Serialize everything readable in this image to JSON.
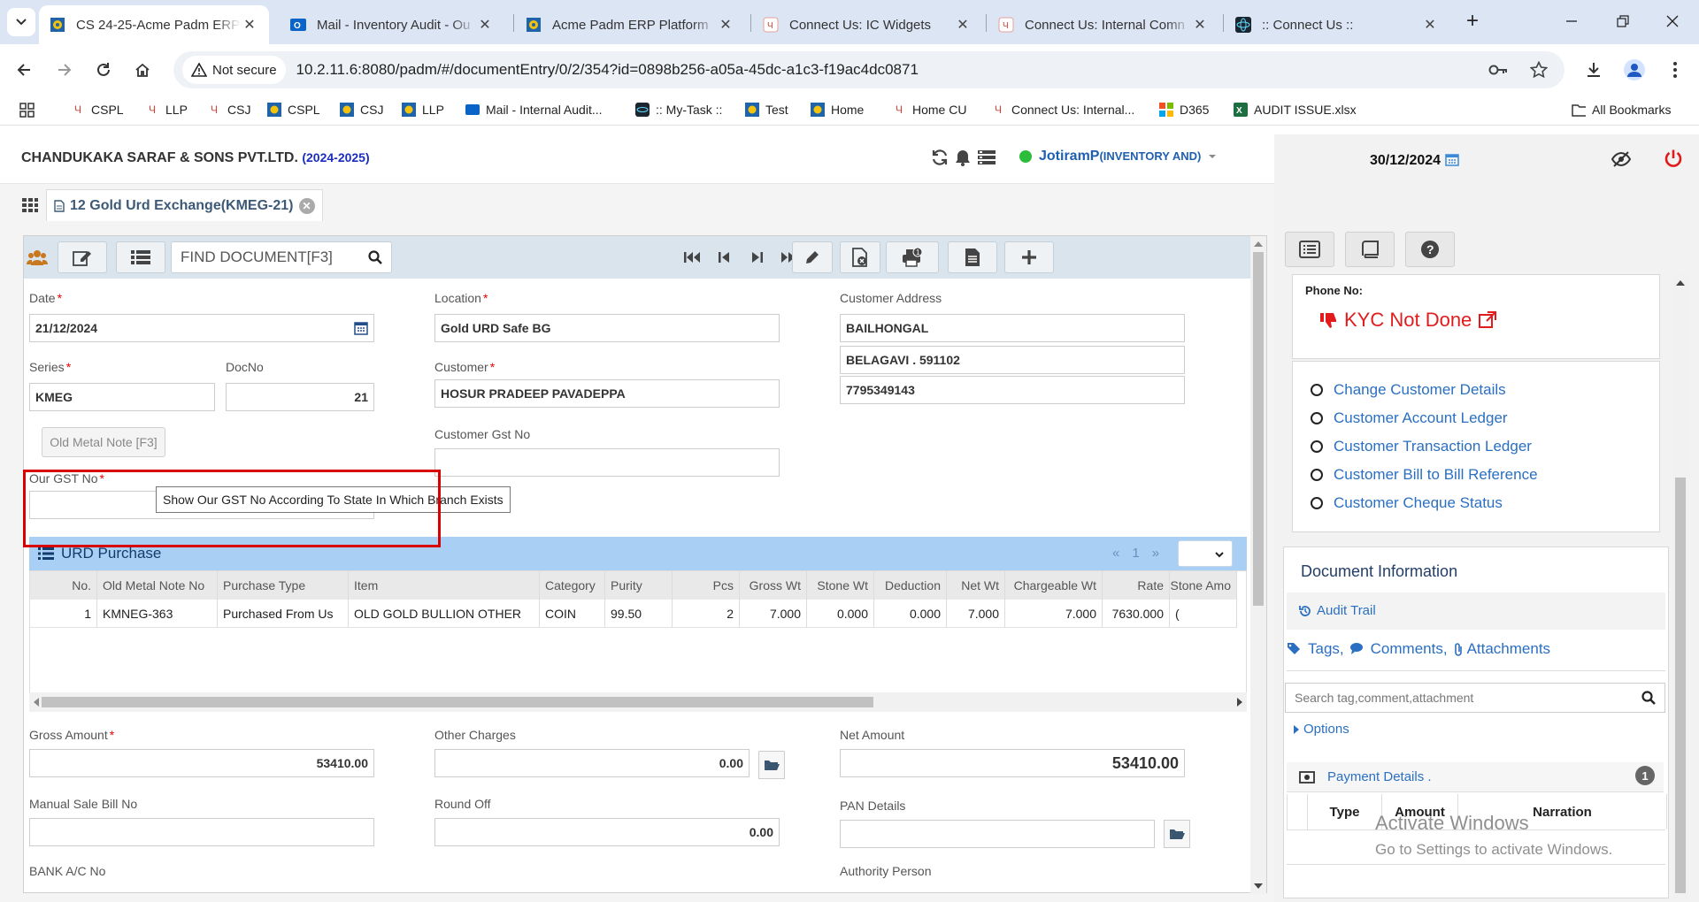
{
  "browser": {
    "tabs": [
      {
        "title": "CS 24-25-Acme Padm ERP",
        "active": true
      },
      {
        "title": "Mail - Inventory Audit - Ou",
        "active": false
      },
      {
        "title": "Acme Padm ERP Platform",
        "active": false
      },
      {
        "title": "Connect Us: IC Widgets",
        "active": false
      },
      {
        "title": "Connect Us: Internal Comn",
        "active": false
      },
      {
        "title": ":: Connect Us ::",
        "active": false
      }
    ],
    "security_label": "Not secure",
    "url": "10.2.11.6:8080/padm/#/documentEntry/0/2/354?id=0898b256-a05a-45dc-a1c3-f19ac4dc0871",
    "bookmarks": [
      "CSPL",
      "LLP",
      "CSJ",
      "CSPL",
      "CSJ",
      "LLP",
      "Mail - Internal Audit...",
      ":: My-Task ::",
      "Test",
      "Home",
      "Home CU",
      "Connect Us: Internal...",
      "D365",
      "AUDIT ISSUE.xlsx"
    ],
    "all_bookmarks": "All Bookmarks"
  },
  "header": {
    "company": "CHANDUKAKA SARAF & SONS PVT.LTD.",
    "year": "(2024-2025)",
    "user": "JotiramP",
    "dept": "(INVENTORY AND)",
    "date": "30/12/2024"
  },
  "doc_tab": {
    "title": "12 Gold Urd Exchange(KMEG-21)"
  },
  "find": {
    "placeholder": "FIND DOCUMENT[F3]"
  },
  "form": {
    "date_label": "Date",
    "date": "21/12/2024",
    "location_label": "Location",
    "location": "Gold URD Safe BG",
    "address_label": "Customer Address",
    "address1": "BAILHONGAL",
    "address2": "BELAGAVI . 591102",
    "address3": "7795349143",
    "series_label": "Series",
    "series": "KMEG",
    "docno_label": "DocNo",
    "docno": "21",
    "customer_label": "Customer",
    "customer": "HOSUR PRADEEP PAVADEPPA",
    "old_metal_btn": "Old Metal Note [F3]",
    "gst_label": "Customer Gst No",
    "gst": "",
    "our_gst_label": "Our GST No",
    "our_gst": "",
    "tooltip": "Show Our GST No According To State In Which Branch Exists"
  },
  "urd": {
    "title": "URD Purchase",
    "pager": {
      "prev": "«",
      "page": "1",
      "next": "»"
    },
    "columns": [
      "No.",
      "Old Metal Note No",
      "Purchase Type",
      "Item",
      "Category",
      "Purity",
      "Pcs",
      "Gross Wt",
      "Stone Wt",
      "Deduction",
      "Net Wt",
      "Chargeable Wt",
      "Rate",
      "Stone Amo"
    ],
    "rows": [
      [
        "1",
        "KMNEG-363",
        "Purchased From Us",
        "OLD GOLD BULLION OTHER",
        "COIN",
        "99.50",
        "2",
        "7.000",
        "0.000",
        "0.000",
        "7.000",
        "7.000",
        "7630.000",
        "("
      ]
    ]
  },
  "totals": {
    "gross_label": "Gross Amount",
    "gross": "53410.00",
    "other_label": "Other Charges",
    "other": "0.00",
    "net_label": "Net Amount",
    "net": "53410.00",
    "manual_label": "Manual Sale Bill No",
    "manual": "",
    "round_label": "Round Off",
    "round": "0.00",
    "pan_label": "PAN Details",
    "pan": "",
    "bank_label": "BANK A/C No",
    "authority_label": "Authority Person"
  },
  "sidebar": {
    "phone_label": "Phone No:",
    "kyc": "KYC Not Done",
    "links": [
      "Change Customer Details",
      "Customer Account Ledger",
      "Customer Transaction Ledger",
      "Customer Bill to Bill Reference",
      "Customer Cheque Status"
    ],
    "doc_info": "Document Information",
    "audit": "Audit Trail",
    "tags": "Tags,",
    "comments": "Comments,",
    "attachments": "Attachments",
    "search_placeholder": "Search tag,comment,attachment",
    "options": "Options",
    "payment": "Payment Details .",
    "payment_count": "1",
    "payment_cols": [
      "Type",
      "Amount",
      "Narration"
    ],
    "watermark1": "Activate Windows",
    "watermark2": "Go to Settings to activate Windows."
  },
  "colors": {
    "accent": "#2a6fc2",
    "required": "#e00000",
    "highlight": "#d80000",
    "urd_bar": "#a9cff5"
  }
}
